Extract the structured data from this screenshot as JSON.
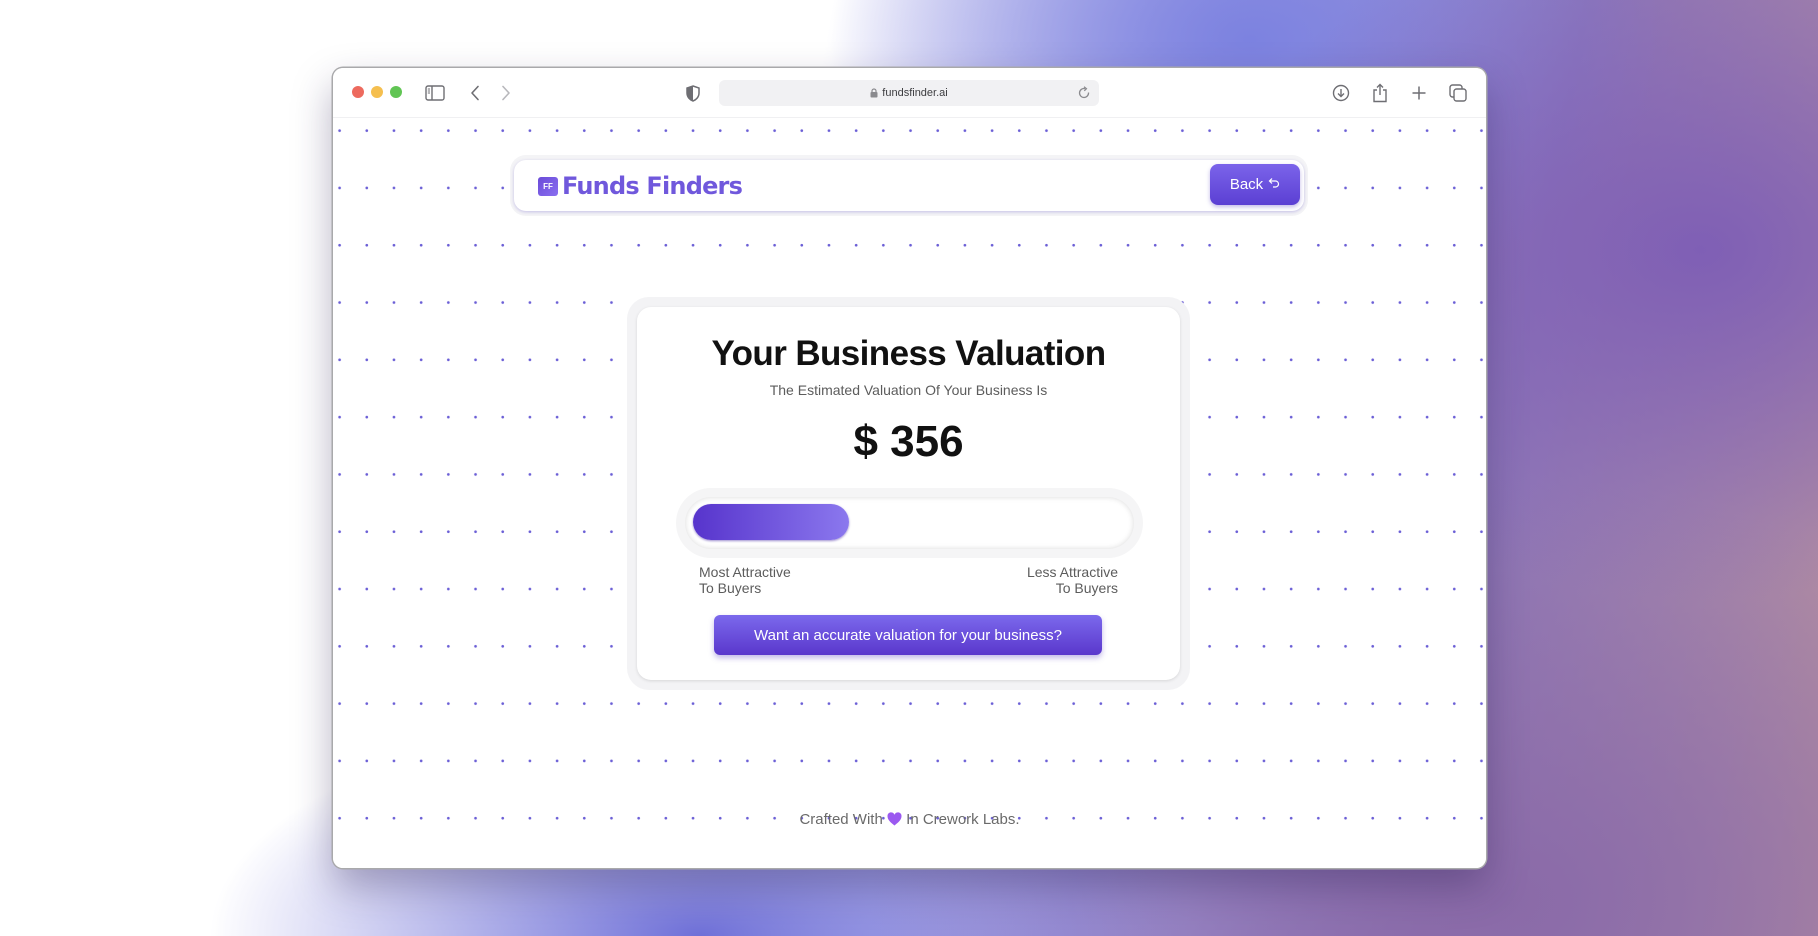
{
  "browser": {
    "url": "fundsfinder.ai",
    "icons": [
      "sidebar-icon",
      "back-arrow-icon",
      "forward-arrow-icon",
      "shield-icon",
      "lock-icon",
      "reload-icon",
      "download-icon",
      "share-icon",
      "new-tab-icon",
      "tab-overview-icon"
    ]
  },
  "header": {
    "logo_mark": "FF",
    "logo_text": "Funds Finders",
    "back_label": "Back",
    "back_icon": "undo-arrow-icon"
  },
  "card": {
    "title": "Your Business Valuation",
    "subtitle": "The Estimated Valuation Of Your Business Is",
    "valuation": "$ 356",
    "progress_fraction": 0.36,
    "scale_left_line1": "Most Attractive",
    "scale_left_line2": "To Buyers",
    "scale_right_line1": "Less Attractive",
    "scale_right_line2": "To Buyers",
    "cta_label": "Want an accurate valuation for your business?"
  },
  "footer": {
    "prefix": "Crafted With",
    "icon": "purple-heart-icon",
    "suffix": "In Crework Labs."
  },
  "colors": {
    "brand": "#7058dc",
    "button_top": "#7b64ea",
    "button_bottom": "#5b3fd3",
    "progress_start": "#5734cc",
    "progress_end": "#8b78ee",
    "heart": "#9b59f0"
  }
}
